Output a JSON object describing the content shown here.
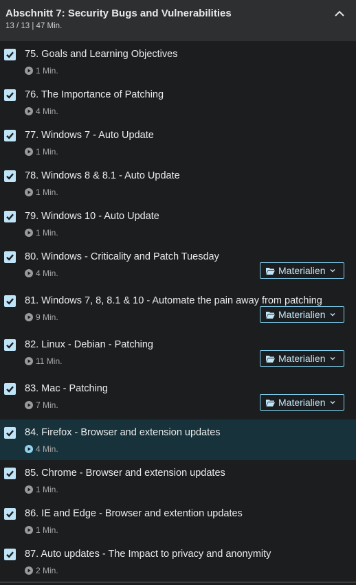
{
  "section": {
    "title": "Abschnitt 7: Security Bugs and Vulnerabilities",
    "meta": "13 / 13 | 47 Min.",
    "collapse_icon": "chevron-up-icon"
  },
  "lectures": [
    {
      "title": "75. Goals and Learning Objectives",
      "duration": "1 Min.",
      "completed": true,
      "resources": false,
      "active": false
    },
    {
      "title": "76. The Importance of Patching",
      "duration": "4 Min.",
      "completed": true,
      "resources": false,
      "active": false
    },
    {
      "title": "77. Windows 7 - Auto Update",
      "duration": "1 Min.",
      "completed": true,
      "resources": false,
      "active": false
    },
    {
      "title": "78. Windows 8 & 8.1 - Auto Update",
      "duration": "1 Min.",
      "completed": true,
      "resources": false,
      "active": false
    },
    {
      "title": "79. Windows 10 - Auto Update",
      "duration": "1 Min.",
      "completed": true,
      "resources": false,
      "active": false
    },
    {
      "title": "80. Windows - Criticality and Patch Tuesday",
      "duration": "4 Min.",
      "completed": true,
      "resources": true,
      "resources_label": "Materialien",
      "active": false
    },
    {
      "title": "81. Windows 7, 8, 8.1 & 10 - Automate the pain away from patching",
      "duration": "9 Min.",
      "completed": true,
      "resources": true,
      "resources_label": "Materialien",
      "active": false
    },
    {
      "title": "82. Linux - Debian - Patching",
      "duration": "11 Min.",
      "completed": true,
      "resources": true,
      "resources_label": "Materialien",
      "active": false
    },
    {
      "title": "83. Mac - Patching",
      "duration": "7 Min.",
      "completed": true,
      "resources": true,
      "resources_label": "Materialien",
      "active": false
    },
    {
      "title": "84. Firefox - Browser and extension updates",
      "duration": "4 Min.",
      "completed": true,
      "resources": false,
      "active": true
    },
    {
      "title": "85. Chrome - Browser and extension updates",
      "duration": "1 Min.",
      "completed": true,
      "resources": false,
      "active": false
    },
    {
      "title": "86. IE and Edge - Browser and extention updates",
      "duration": "1 Min.",
      "completed": true,
      "resources": false,
      "active": false
    },
    {
      "title": "87. Auto updates - The Impact to privacy and anonymity",
      "duration": "2 Min.",
      "completed": true,
      "resources": false,
      "active": false
    }
  ],
  "colors": {
    "accent": "#c0e4f7",
    "active_bg": "#17323a",
    "background": "#1c1d1f"
  }
}
